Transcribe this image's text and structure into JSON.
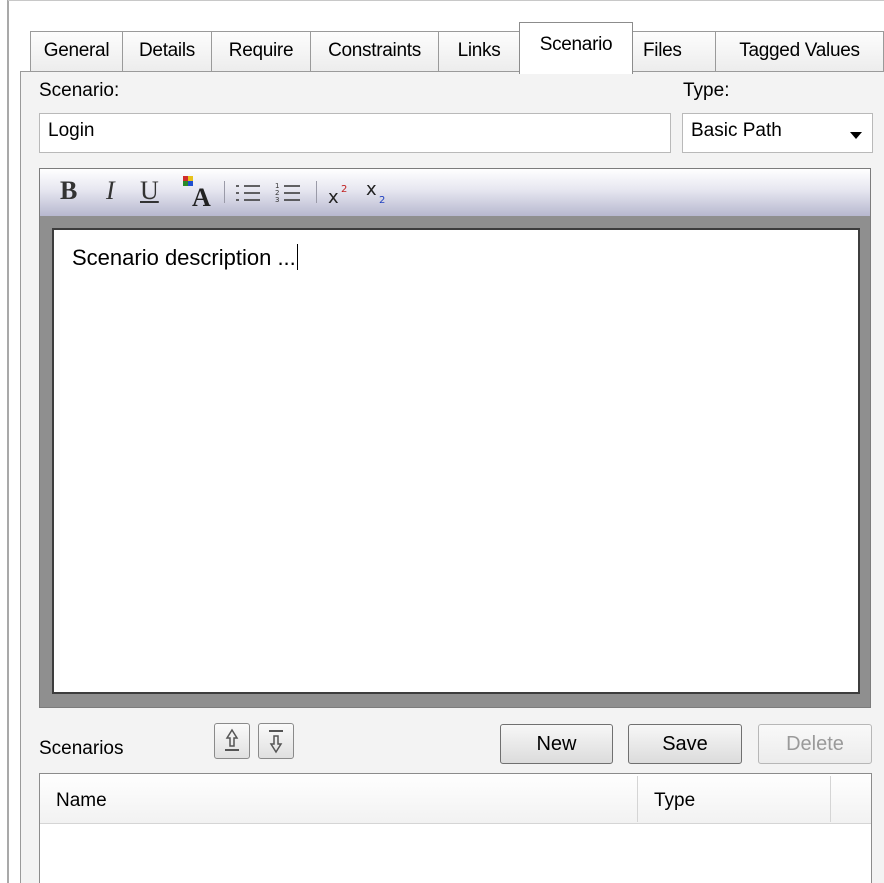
{
  "tabs": [
    {
      "label": "General"
    },
    {
      "label": "Details"
    },
    {
      "label": "Require"
    },
    {
      "label": "Constraints"
    },
    {
      "label": "Links"
    },
    {
      "label": "Scenario",
      "active": true
    },
    {
      "label": "Files"
    },
    {
      "label": "Tagged Values"
    }
  ],
  "form": {
    "scenario_label": "Scenario:",
    "scenario_value": "Login",
    "type_label": "Type:",
    "type_value": "Basic Path"
  },
  "toolbar": {
    "bold": "B",
    "italic": "I",
    "underline": "U",
    "font_color_icon": "font-color-icon",
    "bullet_list_icon": "bullet-list-icon",
    "numbered_list_icon": "numbered-list-icon",
    "superscript_icon": "superscript-icon",
    "subscript_icon": "subscript-icon"
  },
  "editor": {
    "text": "Scenario description ..."
  },
  "scenarios": {
    "label": "Scenarios",
    "move_up_icon": "move-up-icon",
    "move_down_icon": "move-down-icon",
    "new_label": "New",
    "save_label": "Save",
    "delete_label": "Delete",
    "columns": [
      "Name",
      "Type"
    ],
    "rows": []
  },
  "colors": {
    "toolbar_gradient_bottom": "#b7b8cf",
    "panel_bg": "#f3f3f3",
    "disabled_text": "#9a9a9a"
  }
}
